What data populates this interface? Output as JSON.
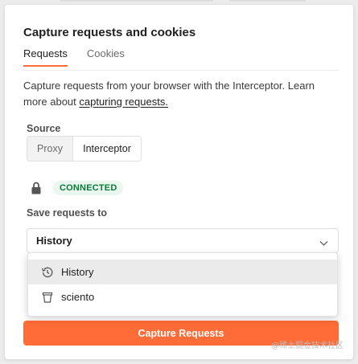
{
  "modal": {
    "title": "Capture requests and cookies",
    "tabs": [
      {
        "label": "Requests",
        "active": true
      },
      {
        "label": "Cookies",
        "active": false
      }
    ],
    "description_text": "Capture requests from your browser with the Interceptor. Learn more about ",
    "description_link": "capturing requests."
  },
  "source": {
    "label": "Source",
    "options": [
      "Proxy",
      "Interceptor"
    ],
    "selected": "Interceptor"
  },
  "status": {
    "icon": "lock-icon",
    "badge": "CONNECTED"
  },
  "save_to": {
    "label": "Save requests to",
    "value": "History",
    "dropdown": [
      {
        "label": "History",
        "icon": "history-icon",
        "highlighted": true
      },
      {
        "label": "sciento",
        "icon": "collection-icon",
        "highlighted": false
      }
    ]
  },
  "actions": {
    "capture_label": "Capture Requests"
  },
  "watermark": "@稀土掘金技术社区",
  "colors": {
    "accent": "#ff6c37",
    "connected_text": "#0b7a3a",
    "connected_bg": "#e9f7ee"
  }
}
